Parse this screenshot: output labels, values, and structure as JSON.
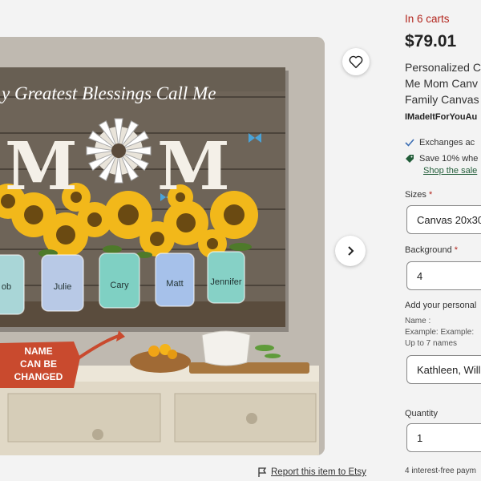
{
  "image": {
    "headline": "y Greatest Blessings Call Me",
    "big_word_left": "M",
    "big_word_right": "M",
    "jar_names": [
      "ob",
      "Julie",
      "Cary",
      "Matt",
      "Jennifer"
    ],
    "sign_text": "NAME CAN BE CHANGED",
    "favorite_icon": "heart-icon",
    "next_icon": "chevron-right-icon"
  },
  "report": {
    "label": "Report this item to Etsy",
    "icon": "flag-icon"
  },
  "listing": {
    "in_carts": "In 6 carts",
    "price": "$79.01",
    "title_lines": [
      "Personalized C",
      "Me Mom Canv",
      "Family Canvas"
    ],
    "shop_name": "IMadeItForYouAu",
    "perks": [
      {
        "icon": "check-icon",
        "text": "Exchanges ac"
      },
      {
        "icon": "tag-icon",
        "text": "Save 10% whe"
      }
    ],
    "perk_link": "Shop the sale",
    "sizes_label": "Sizes",
    "sizes_value": "Canvas 20x30",
    "background_label": "Background",
    "background_value": "4",
    "personal_label": "Add your personal",
    "name_help": [
      "Name :",
      "Example: Example:",
      "Up to 7 names"
    ],
    "names_value": "Kathleen, Willi",
    "quantity_label": "Quantity",
    "quantity_value": "1",
    "payments_text": "4 interest-free paym",
    "colors": {
      "accent_red": "#b3261e",
      "sale_green": "#225d39"
    }
  }
}
